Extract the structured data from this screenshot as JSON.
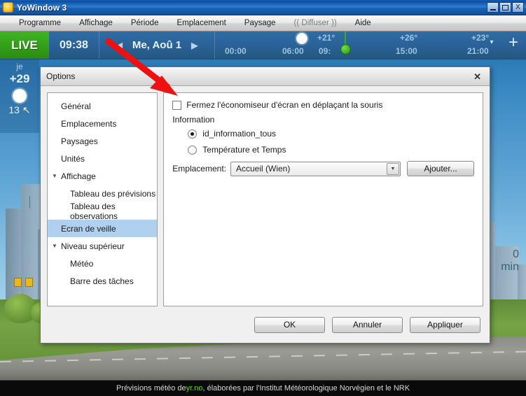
{
  "window": {
    "title": "YoWindow 3",
    "icon": "sun-icon",
    "controls": {
      "minimize": "_",
      "maximize": "□",
      "close": "X"
    }
  },
  "menubar": {
    "items": [
      {
        "label": "Programme",
        "dim": false
      },
      {
        "label": "Affichage",
        "dim": false
      },
      {
        "label": "Période",
        "dim": false
      },
      {
        "label": "Emplacement",
        "dim": false
      },
      {
        "label": "Paysage",
        "dim": false
      },
      {
        "label": "(( Diffuser ))",
        "dim": true
      },
      {
        "label": "Aide",
        "dim": false
      }
    ]
  },
  "livebar": {
    "live_label": "LIVE",
    "clock": "09:38",
    "prev_arrow": "◀",
    "date": "Me, Aoû 1",
    "next_arrow": "▶",
    "timeline": {
      "hours": [
        "00:00",
        "06:00",
        "09:",
        "15:00",
        "21:00"
      ],
      "temps": [
        "+21°",
        "+26°",
        "+23°"
      ],
      "sun_icon": "sun-icon",
      "marker": "now-marker"
    },
    "add_button": "+",
    "dropdown_button": "▾"
  },
  "daycolumn": {
    "day": "je",
    "temp": "+29",
    "icon": "sun-icon",
    "wind_speed": "13",
    "wind_dir": "↖"
  },
  "sidetext": {
    "line1": "0",
    "line2": "min"
  },
  "credits": {
    "before": "Prévisions météo de ",
    "link": "yr.no",
    "after": ", élaborées par l'Institut Météorologique Norvégien et le NRK",
    "link_color": "#66d43c"
  },
  "dialog": {
    "title": "Options",
    "close_label": "✕",
    "tree": [
      {
        "label": "Général",
        "level": "root",
        "twist": "",
        "selected": false
      },
      {
        "label": "Emplacements",
        "level": "root",
        "twist": "",
        "selected": false
      },
      {
        "label": "Paysages",
        "level": "root",
        "twist": "",
        "selected": false
      },
      {
        "label": "Unités",
        "level": "root",
        "twist": "",
        "selected": false
      },
      {
        "label": "Affichage",
        "level": "group",
        "twist": "▼",
        "selected": false
      },
      {
        "label": "Tableau des prévisions",
        "level": "child",
        "twist": "",
        "selected": false
      },
      {
        "label": "Tableau des observations",
        "level": "child",
        "twist": "",
        "selected": false
      },
      {
        "label": "Ecran de veille",
        "level": "root",
        "twist": "",
        "selected": true
      },
      {
        "label": "Niveau supérieur",
        "level": "group",
        "twist": "▼",
        "selected": false
      },
      {
        "label": "Météo",
        "level": "child",
        "twist": "",
        "selected": false
      },
      {
        "label": "Barre des tâches",
        "level": "child",
        "twist": "",
        "selected": false
      }
    ],
    "content": {
      "checkbox_label": "Fermez l'économiseur d'écran en déplaçant la souris",
      "checkbox_checked": false,
      "group_label": "Information",
      "radios": [
        {
          "label": "id_information_tous",
          "selected": true
        },
        {
          "label": "Température et Temps",
          "selected": false
        }
      ],
      "emplacement_label": "Emplacement:",
      "emplacement_value": "Accueil (Wien)",
      "emplacement_arrow": "▼",
      "add_button": "Ajouter..."
    },
    "footer": {
      "ok": "OK",
      "cancel": "Annuler",
      "apply": "Appliquer"
    }
  },
  "annotation": {
    "arrow_color": "#ee1111",
    "kind": "red-arrow-pointing-to-checkbox"
  }
}
